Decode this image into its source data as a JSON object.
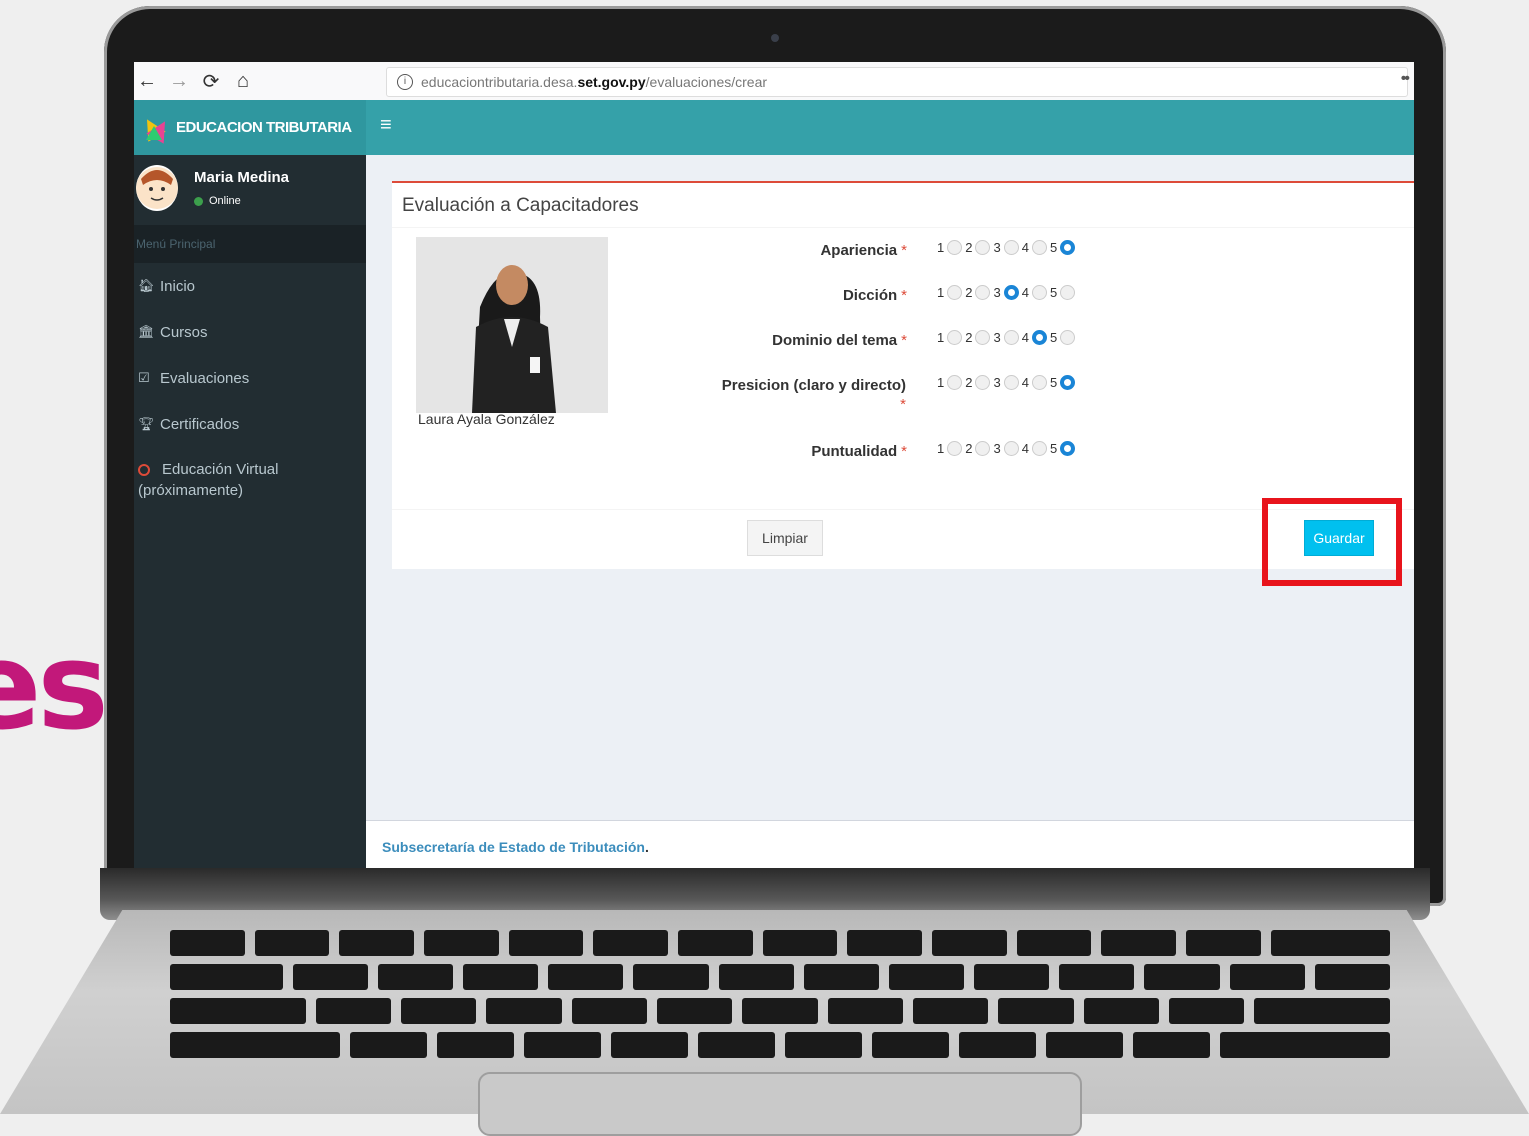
{
  "decorative": {
    "slide_text_fragment": "es"
  },
  "browser": {
    "url_prefix": "educaciontributaria.desa.",
    "url_domain": "set.gov.py",
    "url_path": "/evaluaciones/crear"
  },
  "app": {
    "brand": "EDUCACION TRIBUTARIA",
    "colors": {
      "header": "#35a1a9",
      "sidebar": "#222d32",
      "accent_red": "#dd4b39",
      "primary": "#00c0ef",
      "radio_checked": "#1a85d6"
    }
  },
  "user": {
    "name": "Maria Medina",
    "status": "Online"
  },
  "sidebar": {
    "header": "Menú Principal",
    "items": [
      {
        "label": "Inicio",
        "icon": "home-icon"
      },
      {
        "label": "Cursos",
        "icon": "bank-icon"
      },
      {
        "label": "Evaluaciones",
        "icon": "check-square-icon"
      },
      {
        "label": "Certificados",
        "icon": "trophy-icon"
      },
      {
        "label_line1": "Educación Virtual",
        "label_line2": "(próximamente)",
        "icon": "circle-icon"
      }
    ]
  },
  "form": {
    "title": "Evaluación a Capacitadores",
    "trainer_name": "Laura Ayala González",
    "required_mark": "*",
    "scale": [
      "1",
      "2",
      "3",
      "4",
      "5"
    ],
    "questions": [
      {
        "label": "Apariencia",
        "selected": 5
      },
      {
        "label": "Dicción",
        "selected": 3
      },
      {
        "label": "Dominio del tema",
        "selected": 4
      },
      {
        "label": "Presicion (claro y directo)",
        "selected": 5
      },
      {
        "label": "Puntualidad",
        "selected": 5
      }
    ],
    "clear_label": "Limpiar",
    "save_label": "Guardar"
  },
  "footer": {
    "org": "Subsecretaría de Estado de Tributación",
    "period": "."
  }
}
